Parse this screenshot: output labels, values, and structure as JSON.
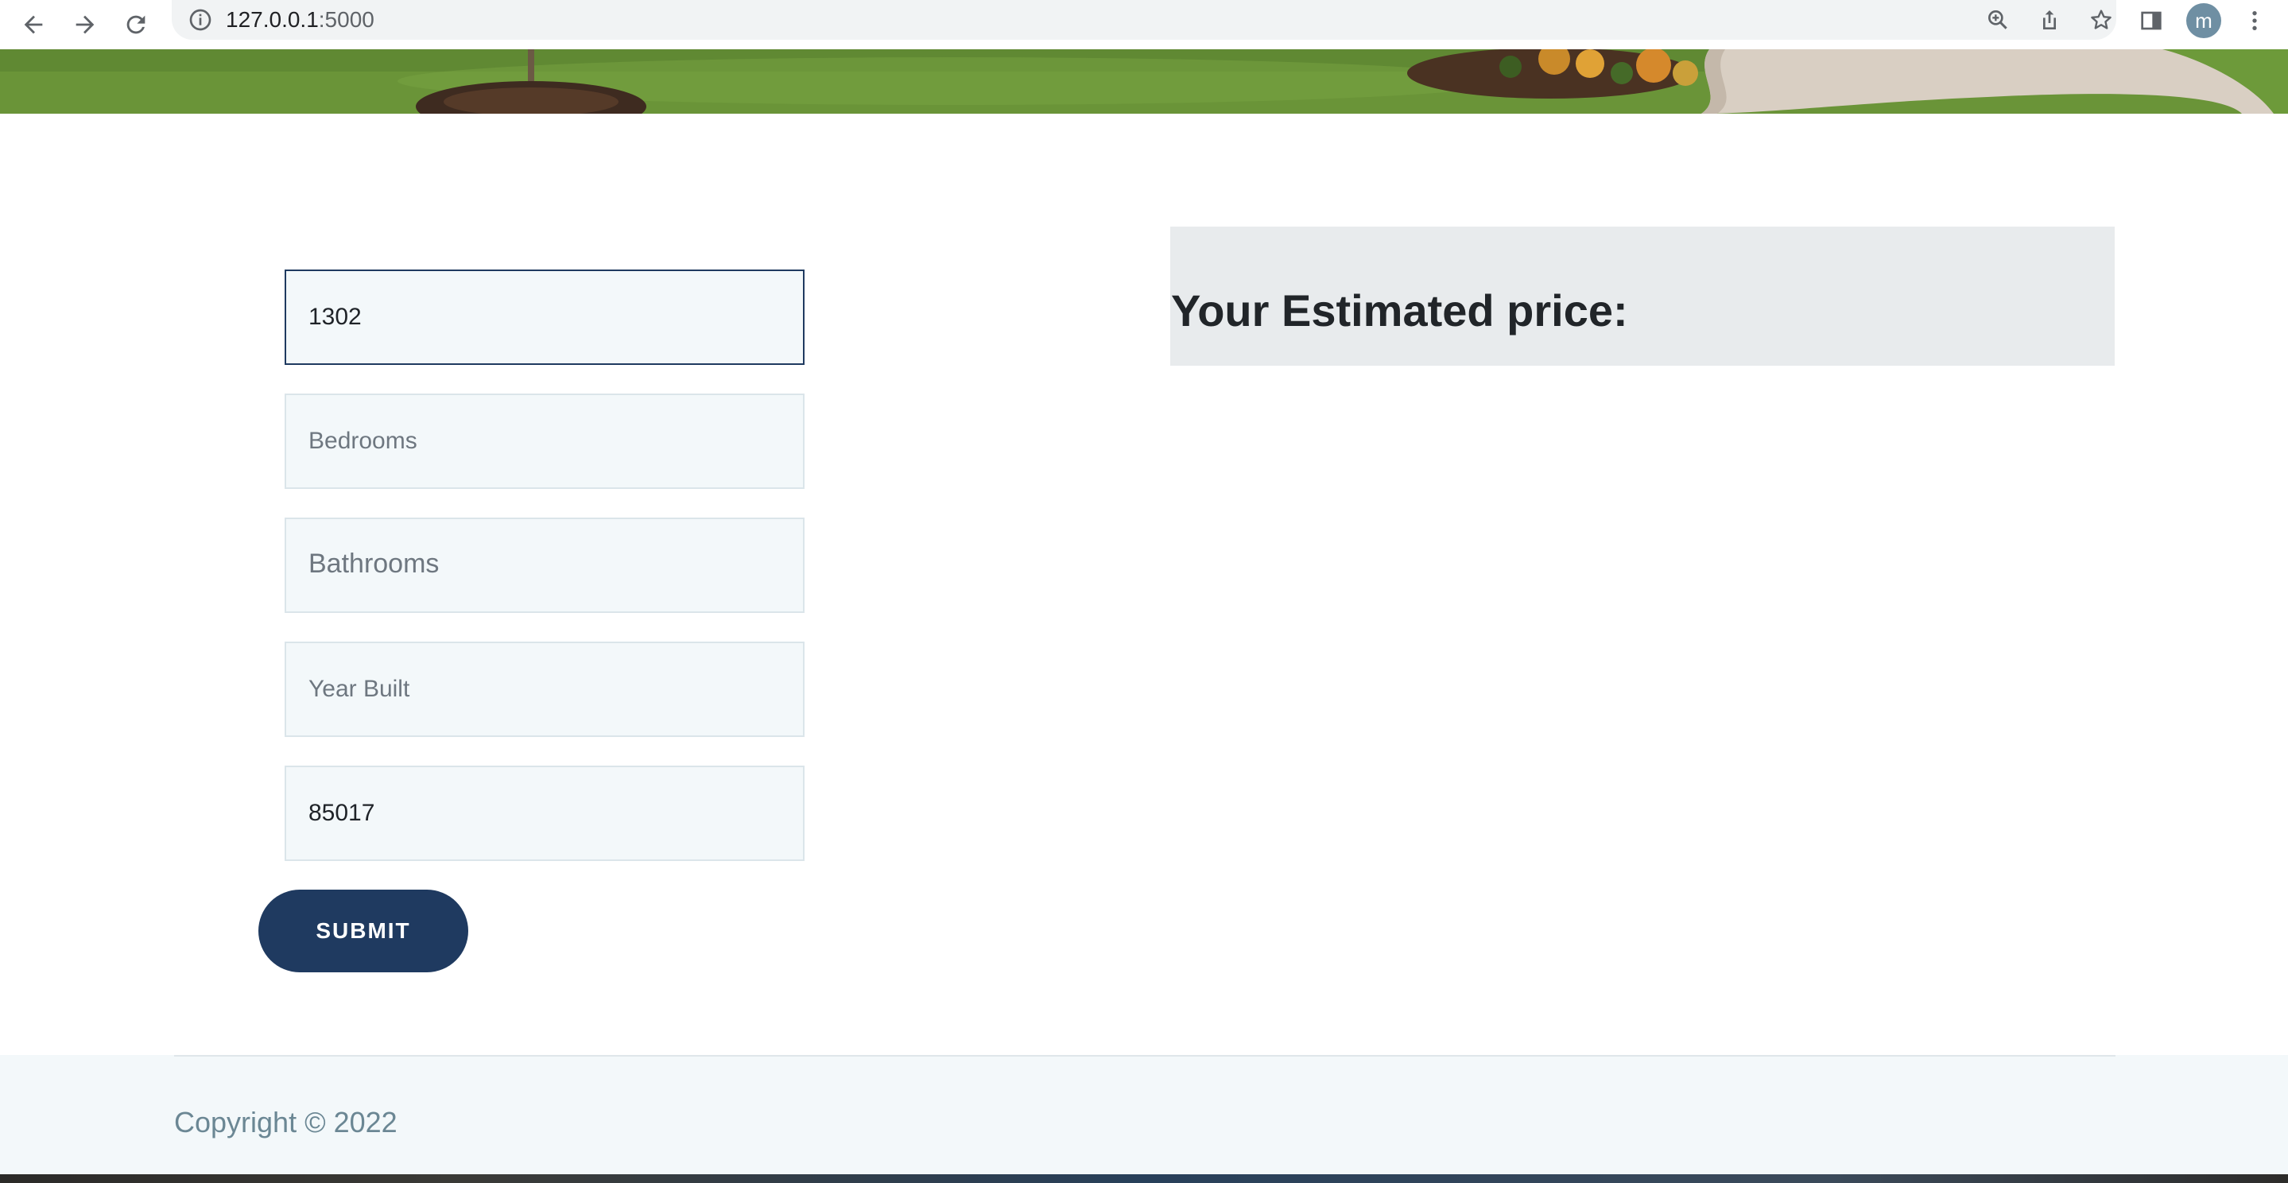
{
  "browser": {
    "url_host": "127.0.0.1",
    "url_port": ":5000",
    "profile_initial": "m"
  },
  "form": {
    "sqft": {
      "value": "1302",
      "placeholder": ""
    },
    "bedrooms": {
      "value": "",
      "placeholder": "Bedrooms"
    },
    "bathrooms": {
      "value": "",
      "placeholder": "Bathrooms"
    },
    "year_built": {
      "value": "",
      "placeholder": "Year Built"
    },
    "zipcode": {
      "value": "85017",
      "placeholder": ""
    },
    "submit_label": "SUBMIT"
  },
  "result": {
    "title": "Your Estimated price:"
  },
  "footer": {
    "copyright": "Copyright © 2022"
  },
  "colors": {
    "accent": "#1f3a60",
    "field_background": "#f3f8fa",
    "result_panel": "#e8ebed",
    "footer_text": "#6b8794"
  },
  "icons": {
    "back": "arrow-left-icon",
    "forward": "arrow-right-icon",
    "reload": "reload-icon",
    "site_info": "info-icon",
    "zoom": "zoom-icon",
    "share": "share-icon",
    "bookmark": "star-icon",
    "side_panel": "side-panel-icon",
    "menu": "kebab-menu-icon"
  }
}
